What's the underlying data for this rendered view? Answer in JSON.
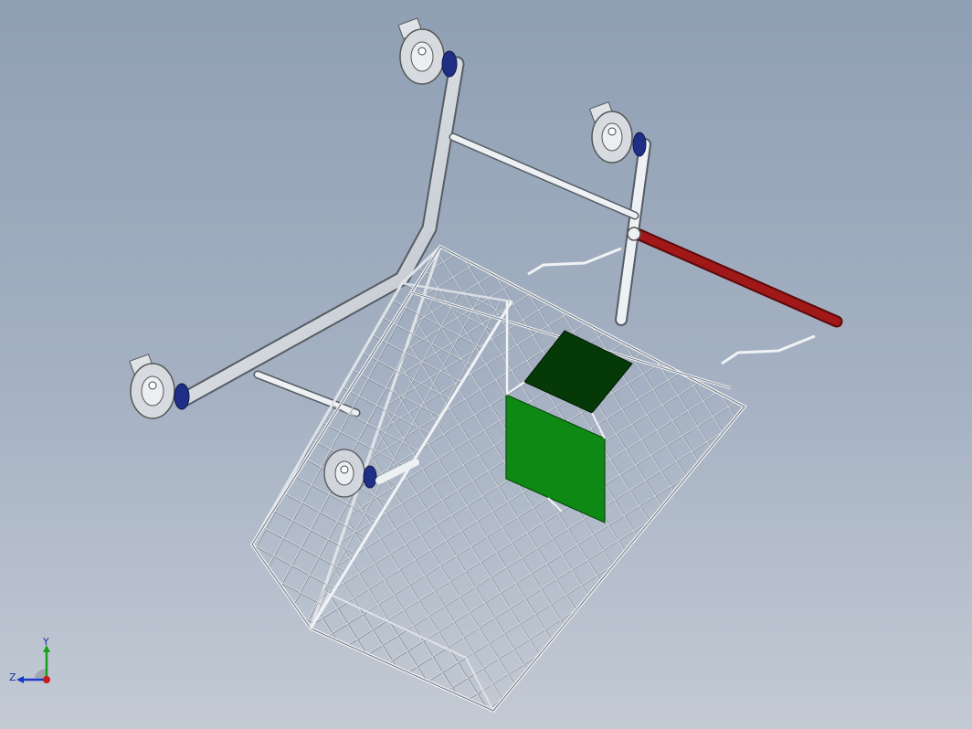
{
  "viewport": {
    "background_top": "#8f9fb4",
    "background_bottom": "#c3cad4",
    "model_colors": {
      "frame": "#e6e9ee",
      "handle": "#a01818",
      "panel_light": "#0e8a14",
      "panel_dark": "#053a08",
      "wheel_tire": "#1f2f86"
    }
  },
  "triad": {
    "y_label": "Y",
    "z_label": "Z",
    "x_color": "#cc1a1a",
    "y_color": "#18a018",
    "z_color": "#1a3acc"
  }
}
